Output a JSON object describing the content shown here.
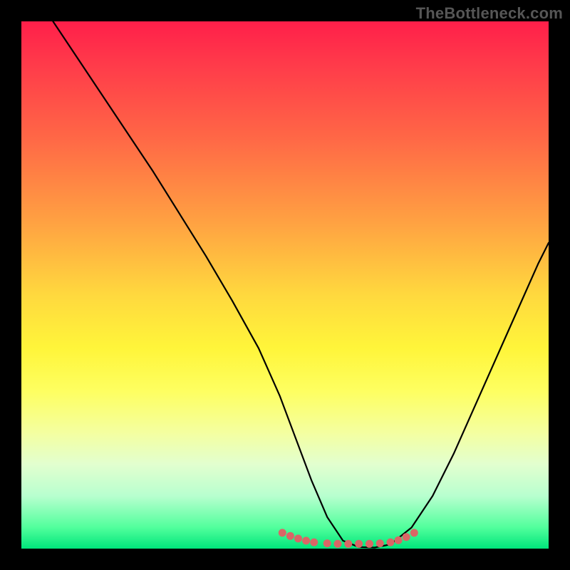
{
  "watermark": "TheBottleneck.com",
  "chart_data": {
    "type": "line",
    "title": "",
    "xlabel": "",
    "ylabel": "",
    "xlim": [
      0,
      100
    ],
    "ylim": [
      0,
      100
    ],
    "grid": false,
    "series": [
      {
        "name": "curve",
        "color": "#000000",
        "x": [
          6,
          10,
          15,
          20,
          25,
          30,
          35,
          40,
          45,
          49,
          52,
          55,
          58,
          61,
          64,
          67,
          70,
          74,
          78,
          82,
          86,
          90,
          94,
          98,
          100
        ],
        "values": [
          100,
          94,
          86.5,
          79,
          71.5,
          63.5,
          55.5,
          47,
          38,
          29,
          21,
          13,
          6,
          1.5,
          0.3,
          0.2,
          0.8,
          4,
          10,
          18,
          27,
          36,
          45,
          54,
          58
        ]
      },
      {
        "name": "highlight-dots",
        "color": "#d96666",
        "x": [
          49.5,
          51,
          52.5,
          54,
          55.5,
          58,
          60,
          62,
          64,
          66,
          68,
          70,
          71.5,
          73,
          74.5
        ],
        "values": [
          3.0,
          2.4,
          1.9,
          1.5,
          1.2,
          1.0,
          0.9,
          0.9,
          0.9,
          0.9,
          1.0,
          1.2,
          1.6,
          2.2,
          3.0
        ]
      }
    ],
    "gradient_stops": [
      {
        "pos": 0.0,
        "color": "#ff1f4a"
      },
      {
        "pos": 0.08,
        "color": "#ff3a4a"
      },
      {
        "pos": 0.22,
        "color": "#ff6746"
      },
      {
        "pos": 0.38,
        "color": "#ffa142"
      },
      {
        "pos": 0.52,
        "color": "#ffd93e"
      },
      {
        "pos": 0.62,
        "color": "#fff53a"
      },
      {
        "pos": 0.7,
        "color": "#feff60"
      },
      {
        "pos": 0.78,
        "color": "#f4ffa0"
      },
      {
        "pos": 0.84,
        "color": "#e2ffcf"
      },
      {
        "pos": 0.9,
        "color": "#b8ffcf"
      },
      {
        "pos": 0.96,
        "color": "#51ff9c"
      },
      {
        "pos": 1.0,
        "color": "#00e57b"
      }
    ]
  }
}
